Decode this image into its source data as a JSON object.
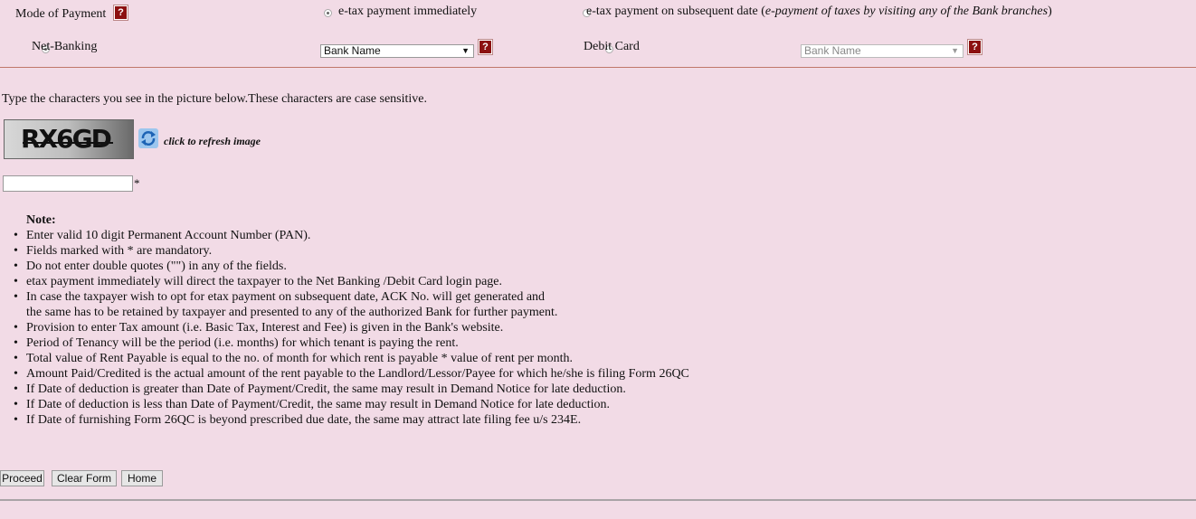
{
  "payment": {
    "mode_label": "Mode of Payment",
    "immediate_label": "e-tax payment immediately",
    "subsequent_label": "e-tax payment on subsequent date (",
    "subsequent_italic": "e-payment of taxes by visiting any of the Bank branches",
    "subsequent_close": ")",
    "netbanking_label": "Net-Banking",
    "netbanking_bank_select": "Bank Name",
    "debitcard_label": "Debit Card",
    "debitcard_bank_select": "Bank Name",
    "help_glyph": "?"
  },
  "captcha": {
    "instruction": "Type the characters you see in the picture below.These characters are case sensitive.",
    "image_text": "RX6GD",
    "refresh_label": "click to refresh image",
    "required_mark": "*"
  },
  "notes": {
    "heading": "Note:",
    "items": [
      "Enter valid 10 digit Permanent Account Number (PAN).",
      "Fields marked with * are mandatory.",
      "Do not enter double quotes (\"\") in any of the fields.",
      "etax payment immediately will direct the taxpayer to the Net Banking /Debit Card login page.",
      "In case the taxpayer wish to opt for etax payment on subsequent date, ACK No. will get generated and",
      "the same has to be retained by taxpayer and presented to any of the authorized Bank for further payment.",
      "Provision to enter Tax amount (i.e. Basic Tax, Interest and Fee) is given in the Bank's website.",
      "Period of Tenancy will be the period (i.e. months) for which tenant is paying the rent.",
      "Total value of Rent Payable is equal to the no. of month for which rent is payable * value of rent per month.",
      "Amount Paid/Credited is the actual amount of the rent payable to the Landlord/Lessor/Payee for which he/she is filing Form 26QC",
      "If Date of deduction is greater than Date of Payment/Credit, the same may result in Demand Notice for late deduction.",
      "If Date of deduction is less than Date of Payment/Credit, the same may result in Demand Notice for late deduction.",
      "If Date of furnishing Form 26QC is beyond prescribed due date, the same may attract late filing fee u/s 234E."
    ]
  },
  "buttons": {
    "proceed": "Proceed",
    "clear": "Clear Form",
    "home": "Home"
  },
  "colors": {
    "background": "#f2dbe6",
    "help_icon": "#8c1010",
    "divider": "#c0786a"
  }
}
